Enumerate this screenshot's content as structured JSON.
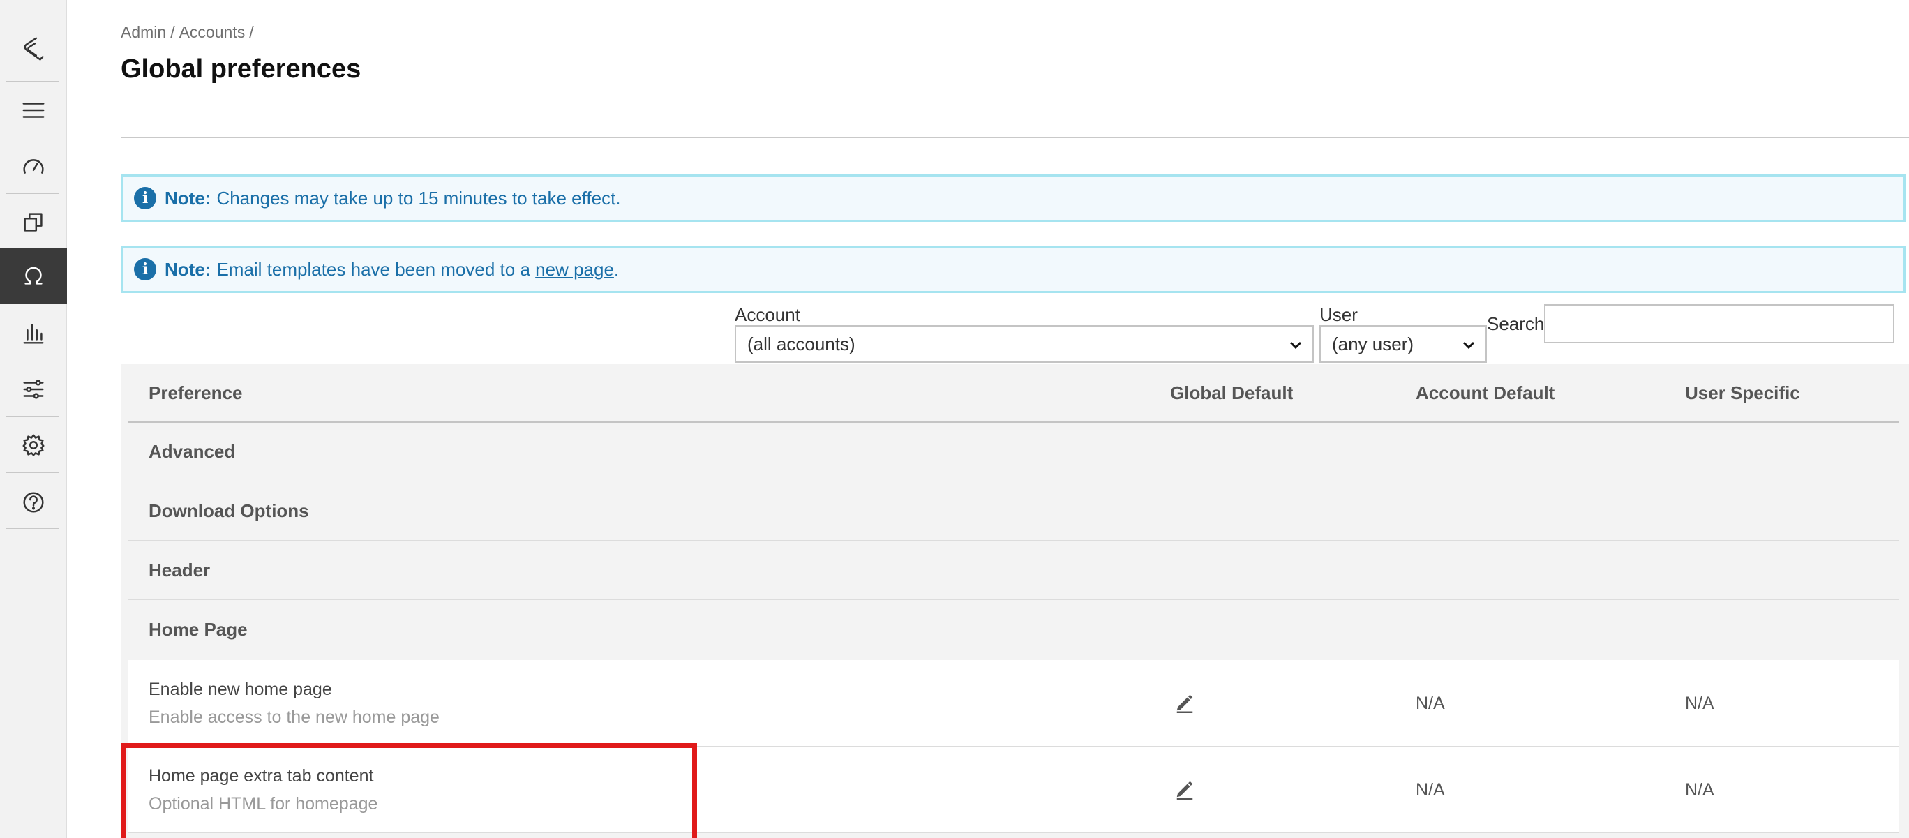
{
  "colors": {
    "accent": "#1a6fa8",
    "note_border": "#a6e4f0",
    "highlight": "#e01a1a",
    "sidebar_active": "#3a3a3a"
  },
  "sidebar": {
    "items": [
      {
        "icon": "logo-icon"
      },
      {
        "icon": "menu-icon"
      },
      {
        "icon": "dashboard-icon"
      },
      {
        "icon": "copy-icon"
      },
      {
        "icon": "omega-icon",
        "active": true
      },
      {
        "icon": "bar-chart-icon"
      },
      {
        "icon": "sliders-icon"
      },
      {
        "icon": "gear-icon"
      },
      {
        "icon": "help-icon"
      }
    ]
  },
  "breadcrumb": {
    "admin": "Admin",
    "sep1": "/",
    "accounts": "Accounts",
    "sep2": "/"
  },
  "page": {
    "title": "Global preferences"
  },
  "notes": {
    "note1": {
      "label": "Note:",
      "text": "Changes may take up to 15 minutes to take effect."
    },
    "note2": {
      "label": "Note:",
      "text": "Email templates have been moved to a",
      "link": "new page",
      "suffix": "."
    }
  },
  "filters": {
    "account": {
      "label": "Account",
      "value": "(all accounts)"
    },
    "user": {
      "label": "User",
      "value": "(any user)"
    },
    "search": {
      "label": "Search",
      "value": ""
    }
  },
  "table": {
    "headers": {
      "preference": "Preference",
      "global_default": "Global Default",
      "account_default": "Account Default",
      "user_specific": "User Specific"
    },
    "groups": [
      "Advanced",
      "Download Options",
      "Header",
      "Home Page"
    ],
    "rows": [
      {
        "name": "Enable new home page",
        "description": "Enable access to the new home page",
        "account_default": "N/A",
        "user_specific": "N/A"
      },
      {
        "name": "Home page extra tab content",
        "description": "Optional HTML for homepage",
        "account_default": "N/A",
        "user_specific": "N/A"
      }
    ]
  }
}
